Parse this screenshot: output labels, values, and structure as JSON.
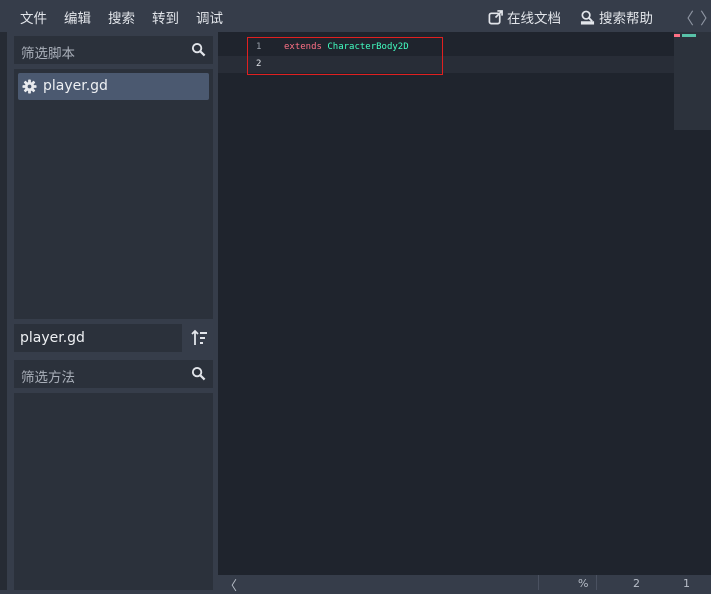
{
  "menu": {
    "items": [
      "文件",
      "编辑",
      "搜索",
      "转到",
      "调试"
    ],
    "online_docs": "在线文档",
    "search_help": "搜索帮助",
    "nav_prev": "〈",
    "nav_next": "〉"
  },
  "scripts_panel": {
    "filter_placeholder": "筛选脚本",
    "items": [
      {
        "label": "player.gd",
        "selected": true
      }
    ],
    "current_script": "player.gd",
    "methods_filter_placeholder": "筛选方法"
  },
  "editor": {
    "lines": [
      {
        "number": "1",
        "tokens": [
          {
            "text": "extends",
            "kind": "keyword"
          },
          {
            "text": " "
          },
          {
            "text": "CharacterBody2D",
            "kind": "type"
          }
        ]
      },
      {
        "number": "2",
        "tokens": []
      }
    ]
  },
  "status": {
    "back_arrow": "〈",
    "zoom": "%",
    "line": "2",
    "col": "1"
  },
  "colors": {
    "keyword": "#ff7085",
    "type": "#42ffc2",
    "highlight_box": "#e02020",
    "selected_item": "#4b5970"
  }
}
